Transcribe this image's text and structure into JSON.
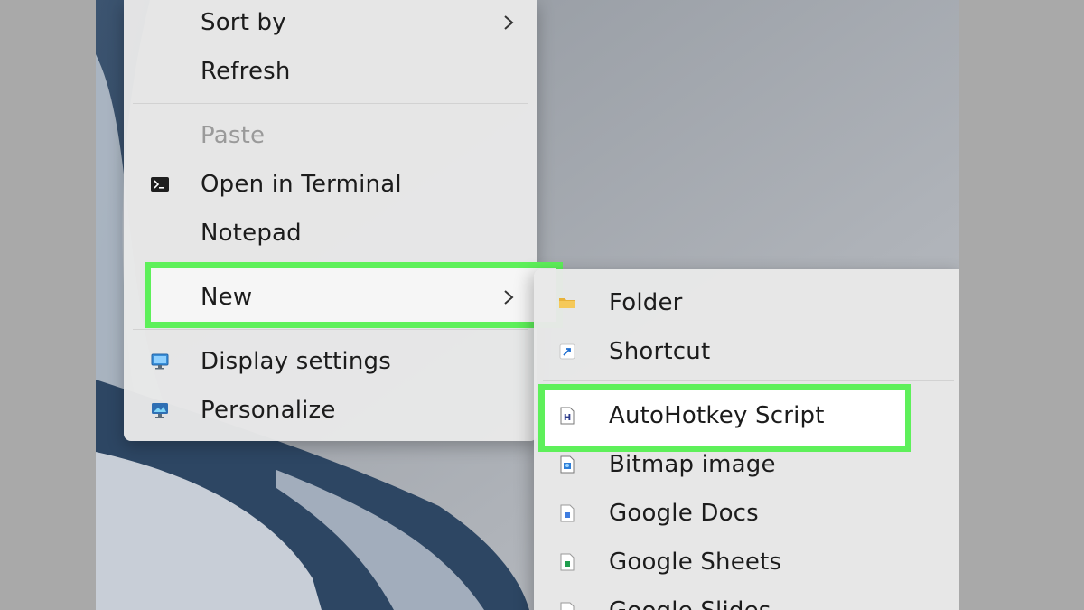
{
  "context_menu": {
    "items": [
      {
        "id": "sort-by",
        "label": "Sort by",
        "has_submenu": true
      },
      {
        "id": "refresh",
        "label": "Refresh"
      },
      {
        "id": "paste",
        "label": "Paste",
        "disabled": true
      },
      {
        "id": "open-in-terminal",
        "label": "Open in Terminal",
        "icon": "terminal-icon"
      },
      {
        "id": "notepad",
        "label": "Notepad"
      },
      {
        "id": "new",
        "label": "New",
        "has_submenu": true,
        "highlighted": true
      },
      {
        "id": "display-settings",
        "label": "Display settings",
        "icon": "display-icon"
      },
      {
        "id": "personalize",
        "label": "Personalize",
        "icon": "personalize-icon"
      }
    ]
  },
  "new_submenu": {
    "items": [
      {
        "id": "folder",
        "label": "Folder",
        "icon": "folder-icon"
      },
      {
        "id": "shortcut",
        "label": "Shortcut",
        "icon": "shortcut-icon"
      },
      {
        "id": "autohotkey-script",
        "label": "AutoHotkey Script",
        "icon": "autohotkey-file-icon",
        "highlighted": true
      },
      {
        "id": "bitmap-image",
        "label": "Bitmap image",
        "icon": "bitmap-file-icon"
      },
      {
        "id": "google-docs",
        "label": "Google Docs",
        "icon": "google-docs-icon"
      },
      {
        "id": "google-sheets",
        "label": "Google Sheets",
        "icon": "google-sheets-icon"
      },
      {
        "id": "google-slides",
        "label": "Google Slides",
        "icon": "google-slides-icon"
      }
    ]
  },
  "colors": {
    "highlight_border": "#5ef05a",
    "menu_background": "#e8e8e8",
    "disabled_text": "#9a9a9a"
  }
}
